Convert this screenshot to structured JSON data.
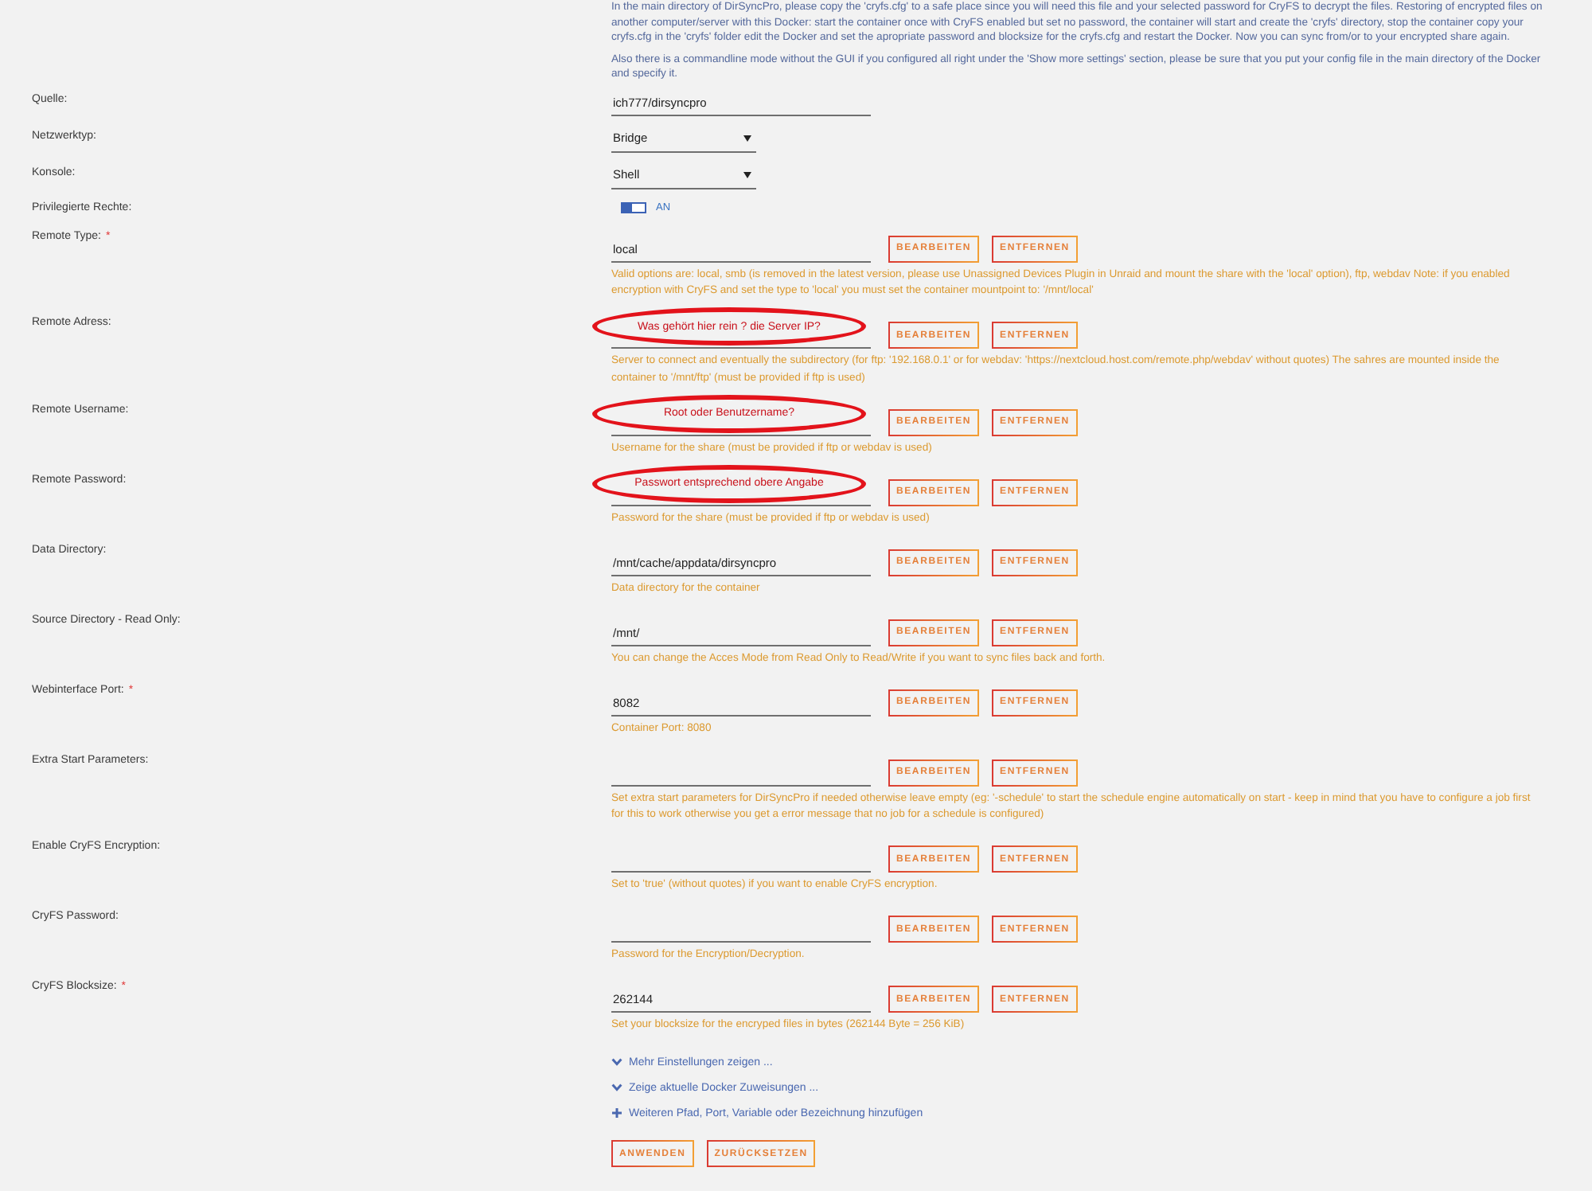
{
  "intro": [
    "In the main directory of DirSyncPro, please copy the 'cryfs.cfg' to a safe place since you will need this file and your selected password for CryFS to decrypt the files. Restoring of encrypted files on another computer/server with this Docker: start the container once with CryFS enabled but set no password, the container will start and create the 'cryfs' directory, stop the container copy your cryfs.cfg in the 'cryfs' folder edit the Docker and set the apropriate password and blocksize for the cryfs.cfg and restart the Docker. Now you can sync from/or to your encrypted share again.",
    "Also there is a commandline mode without the GUI if you configured all right under the 'Show more settings' section, please be sure that you put your config file in the main directory of the Docker and specify it."
  ],
  "rows": [
    {
      "kind": "text",
      "label": "Quelle:",
      "value": "ich777/dirsyncpro"
    },
    {
      "kind": "select",
      "label": "Netzwerktyp:",
      "value": "Bridge"
    },
    {
      "kind": "select",
      "label": "Konsole:",
      "value": "Shell"
    },
    {
      "kind": "toggle",
      "label": "Privilegierte Rechte:",
      "on": true,
      "state_label": "AN"
    },
    {
      "kind": "config",
      "label": "Remote Type:",
      "required_mark": "*",
      "value": "local",
      "buttons": [
        "BEARBEITEN",
        "ENTFERNEN"
      ],
      "help": "Valid options are: local, smb (is removed in the latest version, please use Unassigned Devices Plugin in Unraid and mount the share with the 'local' option), ftp, webdav Note: if you enabled encryption with CryFS and set the type to 'local' you must set the container mountpoint to: '/mnt/local'"
    },
    {
      "kind": "config",
      "label": "Remote Adress:",
      "annotation": "Was gehört hier rein ? die Server IP?",
      "buttons": [
        "BEARBEITEN",
        "ENTFERNEN"
      ],
      "help": "Server to connect and eventually the subdirectory (for ftp: '192.168.0.1' or for webdav: 'https://nextcloud.host.com/remote.php/webdav' without quotes) The sahres are mounted inside the container to '/mnt/ftp' (must be provided if ftp is used)"
    },
    {
      "kind": "config",
      "label": "Remote Username:",
      "annotation": "Root oder Benutzername?",
      "buttons": [
        "BEARBEITEN",
        "ENTFERNEN"
      ],
      "help": "Username for the share (must be provided if ftp or webdav is used)"
    },
    {
      "kind": "config",
      "label": "Remote Password:",
      "annotation": "Passwort entsprechend obere Angabe",
      "buttons": [
        "BEARBEITEN",
        "ENTFERNEN"
      ],
      "help": "Password for the share (must be provided if ftp or webdav is used)"
    },
    {
      "kind": "config",
      "label": "Data Directory:",
      "value": "/mnt/cache/appdata/dirsyncpro",
      "buttons": [
        "BEARBEITEN",
        "ENTFERNEN"
      ],
      "help": "Data directory for the container"
    },
    {
      "kind": "config",
      "label": "Source Directory - Read Only:",
      "value": "/mnt/",
      "buttons": [
        "BEARBEITEN",
        "ENTFERNEN"
      ],
      "help": "You can change the Acces Mode from Read Only to Read/Write if you want to sync files back and forth."
    },
    {
      "kind": "config",
      "label": "Webinterface Port:",
      "required_mark": "*",
      "value": "8082",
      "buttons": [
        "BEARBEITEN",
        "ENTFERNEN"
      ],
      "help": "Container Port: 8080"
    },
    {
      "kind": "config",
      "label": "Extra Start Parameters:",
      "buttons": [
        "BEARBEITEN",
        "ENTFERNEN"
      ],
      "help": "Set extra start parameters for DirSyncPro if needed otherwise leave empty (eg: '-schedule' to start the schedule engine automatically on start - keep in mind that you have to configure a job first for this to work otherwise you get a error message that no job for a schedule is configured)"
    },
    {
      "kind": "config",
      "label": "Enable CryFS Encryption:",
      "buttons": [
        "BEARBEITEN",
        "ENTFERNEN"
      ],
      "help": "Set to 'true' (without quotes) if you want to enable CryFS encryption."
    },
    {
      "kind": "config",
      "label": "CryFS Password:",
      "buttons": [
        "BEARBEITEN",
        "ENTFERNEN"
      ],
      "help": "Password for the Encryption/Decryption."
    },
    {
      "kind": "config",
      "label": "CryFS Blocksize:",
      "required_mark": "*",
      "value": "262144",
      "buttons": [
        "BEARBEITEN",
        "ENTFERNEN"
      ],
      "help": "Set your blocksize for the encryped files in bytes (262144 Byte = 256 KiB)"
    }
  ],
  "links": [
    {
      "kind": "expand",
      "label": "Mehr Einstellungen zeigen ..."
    },
    {
      "kind": "expand",
      "label": "Zeige aktuelle Docker Zuweisungen ..."
    },
    {
      "kind": "add",
      "label": "Weiteren Pfad, Port, Variable oder Bezeichnung hinzufügen"
    }
  ],
  "actions": [
    "ANWENDEN",
    "ZURÜCKSETZEN"
  ]
}
